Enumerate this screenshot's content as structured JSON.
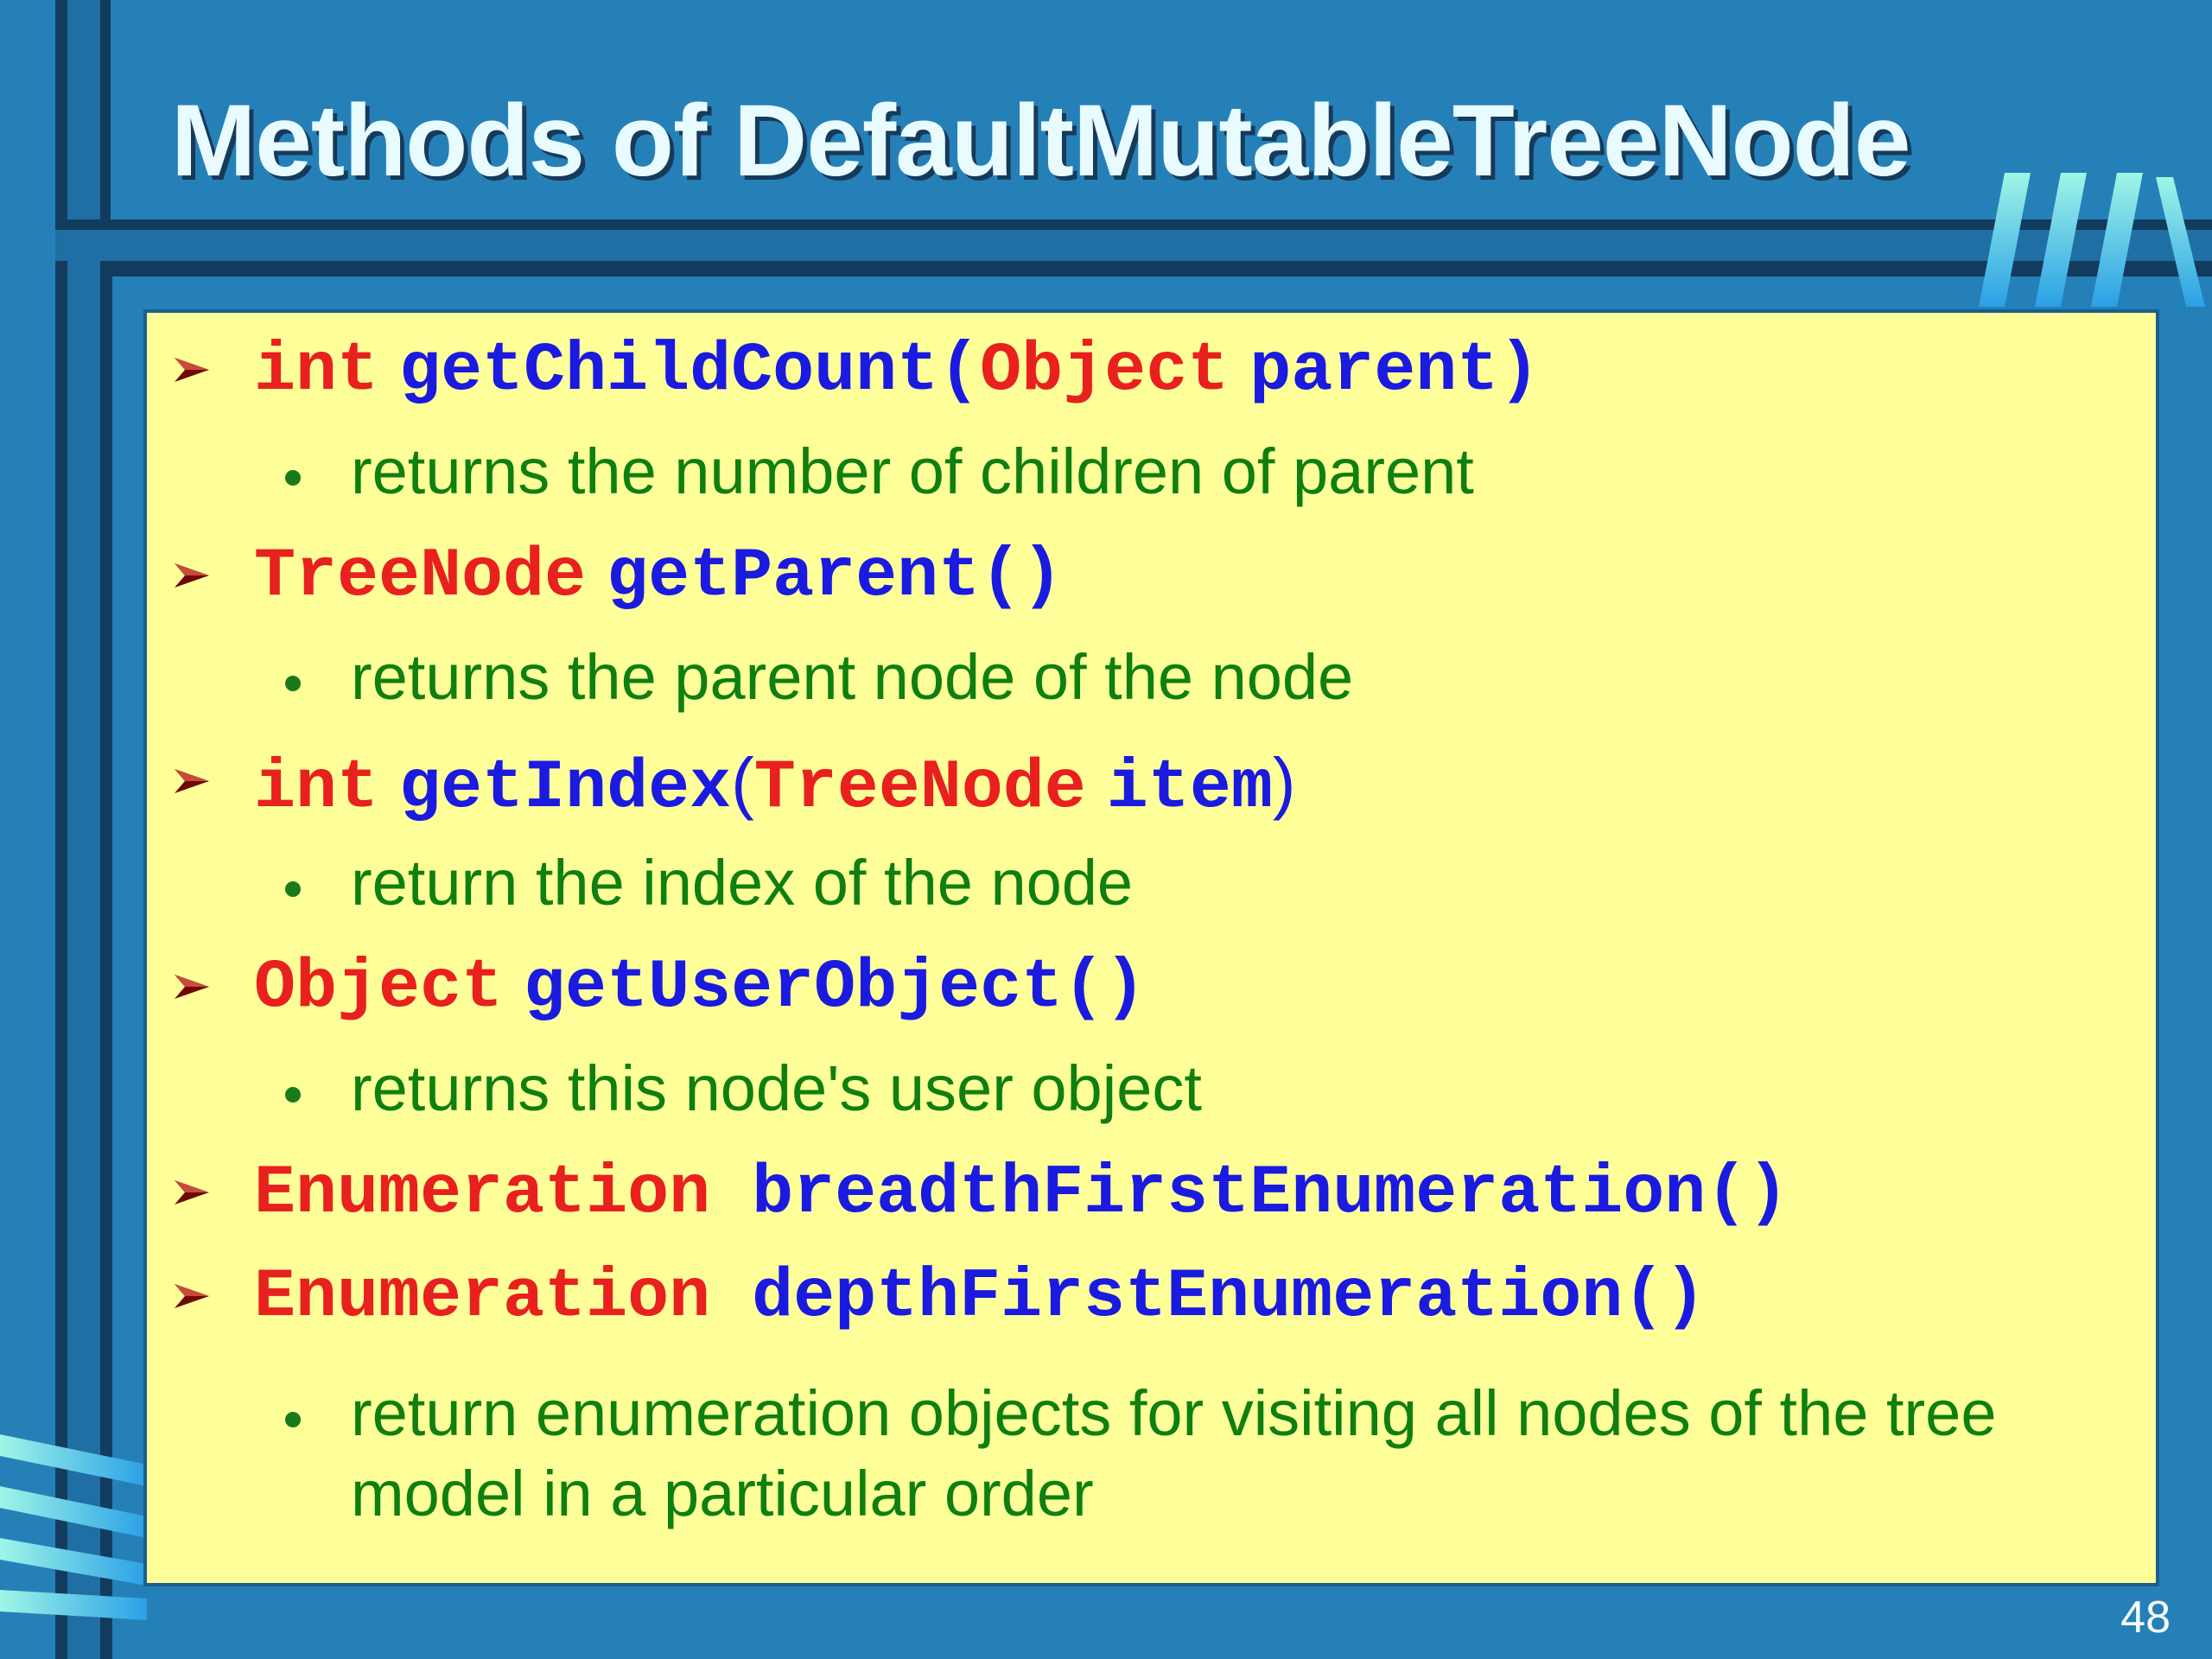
{
  "slide": {
    "title": "Methods of DefaultMutableTreeNode",
    "page_number": "48"
  },
  "colors": {
    "background": "#2680b8",
    "content_background": "#ffff99",
    "keyword": "#e8201e",
    "method": "#1a1ae0",
    "description": "#0f7f0f"
  },
  "methods": [
    {
      "return_type": "int",
      "name": "getChildCount",
      "open": "(",
      "param_type": "Object",
      "param_name": "parent",
      "close": ")",
      "description": "returns the number of children of parent"
    },
    {
      "return_type": "TreeNode",
      "name": "getParent",
      "parens": "()",
      "description": "returns the parent node of the node"
    },
    {
      "return_type": "int",
      "name": "getIndex",
      "open": "(",
      "param_type": "TreeNode",
      "param_name": "item",
      "close": ")",
      "description": "return the index of the node"
    },
    {
      "return_type": "Object",
      "name": "getUserObject",
      "parens": "()",
      "description": "returns this node's user object"
    },
    {
      "return_type": "Enumeration",
      "name": "breadthFirstEnumeration",
      "parens": "()"
    },
    {
      "return_type": "Enumeration",
      "name": "depthFirstEnumeration",
      "parens": "()",
      "description_line1": "return enumeration objects for visiting all nodes of the tree",
      "description_line2": "model in a particular order"
    }
  ]
}
